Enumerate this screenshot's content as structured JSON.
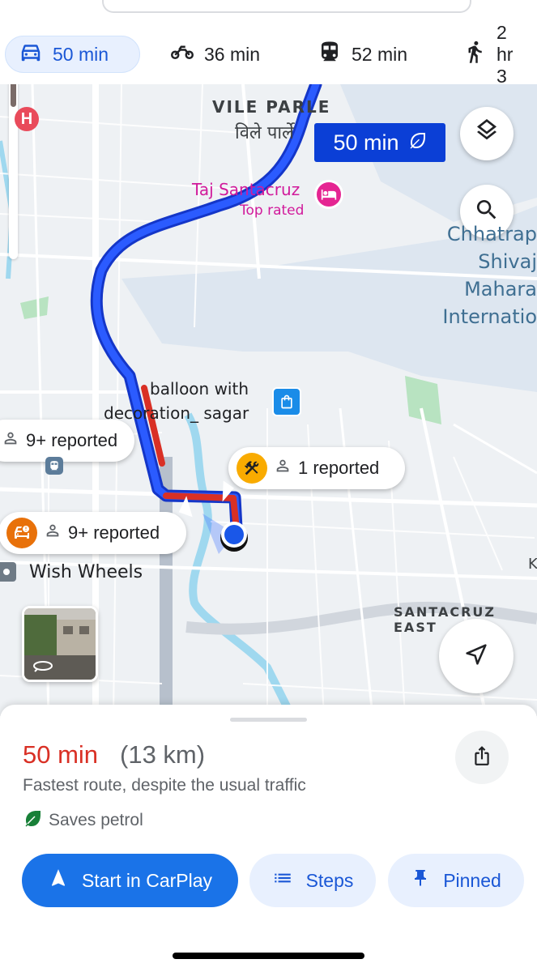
{
  "modes": [
    {
      "icon": "car-icon",
      "label": "50 min",
      "active": true
    },
    {
      "icon": "motorbike-icon",
      "label": "36 min",
      "active": false
    },
    {
      "icon": "train-icon",
      "label": "52 min",
      "active": false
    },
    {
      "icon": "walk-icon",
      "label": "2 hr 3",
      "active": false
    }
  ],
  "map": {
    "area_vile_parle": "VILE PARLE",
    "area_vile_parle_hindi": "विले पार्ले",
    "route_badge": "50 min",
    "hotel_name": "Taj Santacruz",
    "hotel_tag": "Top rated",
    "airport_lines": [
      "Chhatrap",
      "Shivaj",
      "Mahara",
      "Internatio"
    ],
    "shop_name_line1": "balloon with",
    "shop_name_line2": "decoration_ sagar",
    "report_left_top": "9+ reported",
    "report_roadwork": "1 reported",
    "report_left_bottom": "9+ reported",
    "wish_wheels": "Wish Wheels",
    "santacruz_east": "SANTACRUZ EAST",
    "edge_k": "K"
  },
  "colors": {
    "route_blue": "#1a3fe0",
    "traffic_red": "#d93025",
    "accent": "#1a73e8",
    "duration_red": "#d93025"
  },
  "sheet": {
    "duration": "50 min",
    "distance": "(13 km)",
    "subtitle": "Fastest route, despite the usual traffic",
    "eco": "Saves petrol",
    "start_label": "Start in CarPlay",
    "steps_label": "Steps",
    "pinned_label": "Pinned"
  }
}
